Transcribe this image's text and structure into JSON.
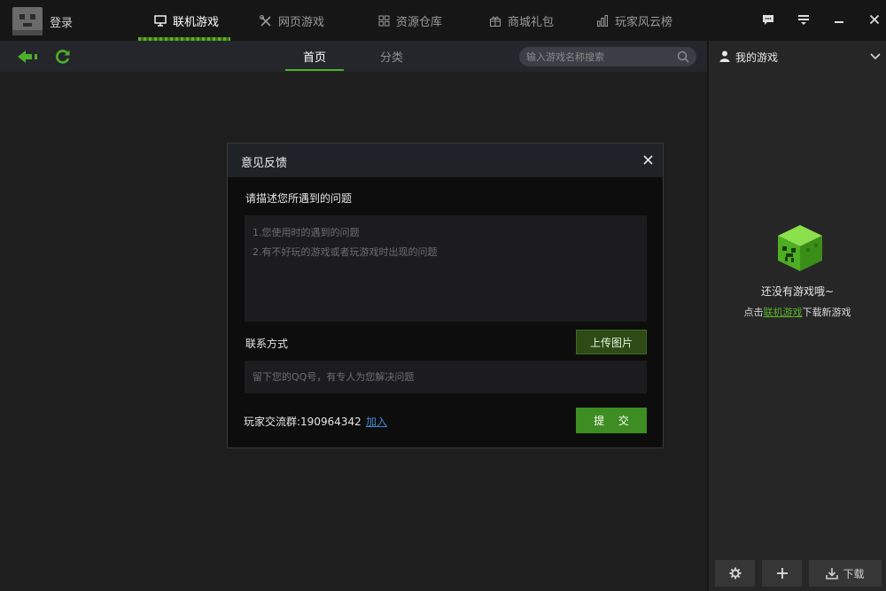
{
  "header": {
    "login_label": "登录",
    "tabs": [
      {
        "label": "联机游戏",
        "icon": "monitor-icon",
        "active": true
      },
      {
        "label": "网页游戏",
        "icon": "tools-icon",
        "active": false
      },
      {
        "label": "资源仓库",
        "icon": "grid-icon",
        "active": false
      },
      {
        "label": "商城礼包",
        "icon": "gift-icon",
        "active": false
      },
      {
        "label": "玩家风云榜",
        "icon": "bar-chart-icon",
        "active": false
      }
    ],
    "accent": "#4caf2a"
  },
  "toolbar": {
    "subtabs": [
      {
        "label": "首页",
        "active": true
      },
      {
        "label": "分类",
        "active": false
      }
    ],
    "search_placeholder": "输入游戏名称搜索"
  },
  "sidebar": {
    "title": "我的游戏",
    "empty_title": "还没有游戏哦~",
    "tip_prefix": "点击",
    "tip_link": "联机游戏",
    "tip_suffix": "下载新游戏",
    "download_label": "下载"
  },
  "dialog": {
    "title": "意见反馈",
    "question_label": "请描述您所遇到的问题",
    "problem_placeholder": "1.您使用时的遇到的问题\n2.有不好玩的游戏或者玩游戏时出现的问题",
    "contact_label": "联系方式",
    "upload_label": "上传图片",
    "qq_placeholder": "留下您的QQ号，有专人为您解决问题",
    "group_text": "玩家交流群:190964342",
    "join_label": "加入",
    "submit_label": "提 交"
  }
}
